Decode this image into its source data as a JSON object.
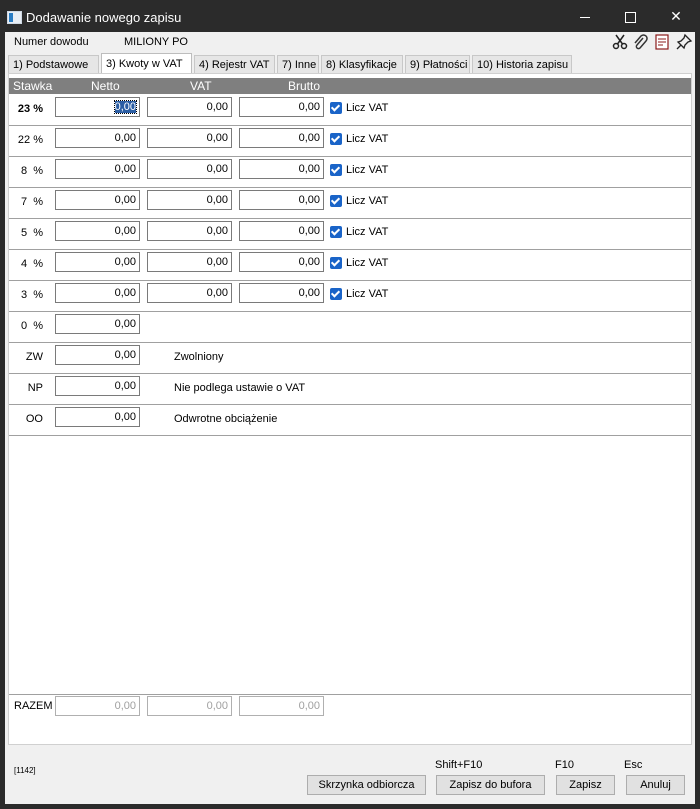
{
  "window": {
    "title": "Dodawanie nowego zapisu"
  },
  "header": {
    "doc_label": "Numer dowodu",
    "doc_value": "MILIONY PO"
  },
  "tabs": [
    {
      "label": "1) Podstawowe"
    },
    {
      "label": "3) Kwoty w VAT",
      "active": true
    },
    {
      "label": "4) Rejestr VAT"
    },
    {
      "label": "7) Inne"
    },
    {
      "label": "8) Klasyfikacje"
    },
    {
      "label": "9) Płatności"
    },
    {
      "label": "10) Historia zapisu"
    }
  ],
  "columns": {
    "rate": "Stawka",
    "net": "Netto",
    "vat": "VAT",
    "gross": "Brutto"
  },
  "rows": [
    {
      "rate": "23 %",
      "net": "0,00",
      "vat": "0,00",
      "gross": "0,00",
      "check": "Licz VAT"
    },
    {
      "rate": "22 %",
      "net": "0,00",
      "vat": "0,00",
      "gross": "0,00",
      "check": "Licz VAT"
    },
    {
      "rate": "8  %",
      "net": "0,00",
      "vat": "0,00",
      "gross": "0,00",
      "check": "Licz VAT"
    },
    {
      "rate": "7  %",
      "net": "0,00",
      "vat": "0,00",
      "gross": "0,00",
      "check": "Licz VAT"
    },
    {
      "rate": "5  %",
      "net": "0,00",
      "vat": "0,00",
      "gross": "0,00",
      "check": "Licz VAT"
    },
    {
      "rate": "4  %",
      "net": "0,00",
      "vat": "0,00",
      "gross": "0,00",
      "check": "Licz VAT"
    },
    {
      "rate": "3  %",
      "net": "0,00",
      "vat": "0,00",
      "gross": "0,00",
      "check": "Licz VAT"
    },
    {
      "rate": "0  %",
      "net": "0,00"
    },
    {
      "rate": "ZW",
      "net": "0,00",
      "desc": "Zwolniony"
    },
    {
      "rate": "NP",
      "net": "0,00",
      "desc": "Nie podlega ustawie o VAT"
    },
    {
      "rate": "OO",
      "net": "0,00",
      "desc": "Odwrotne obciążenie"
    }
  ],
  "totals": {
    "label": "RAZEM",
    "net": "0,00",
    "vat": "0,00",
    "gross": "0,00"
  },
  "footer": {
    "code": "[1142]",
    "buttons": [
      {
        "label": "Skrzynka odbiorcza",
        "shortcut": ""
      },
      {
        "label": "Zapisz do bufora",
        "shortcut": "Shift+F10"
      },
      {
        "label": "Zapisz",
        "shortcut": "F10"
      },
      {
        "label": "Anuluj",
        "shortcut": "Esc"
      }
    ]
  }
}
